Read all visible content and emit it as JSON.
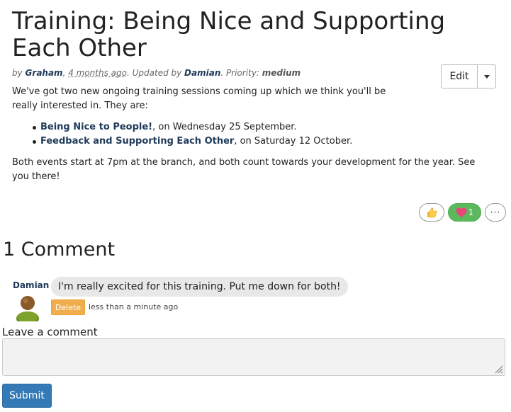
{
  "post": {
    "title": "Training: Being Nice and Supporting Each Other",
    "meta": {
      "by_prefix": "by ",
      "author": "Graham",
      "sep1": ", ",
      "posted_ago": "4 months ago",
      "updated_prefix": ". Updated by ",
      "updated_by": "Damian",
      "priority_prefix": ". Priority: ",
      "priority": "medium"
    },
    "intro": "We've got two new ongoing training sessions coming up which we think you'll be really interested in. They are:",
    "events": [
      {
        "name": "Being Nice to People!",
        "detail": ", on Wednesday 25 September."
      },
      {
        "name": "Feedback and Supporting Each Other",
        "detail": ", on Saturday 12 October."
      }
    ],
    "closing": "Both events start at 7pm at the branch, and both count towards your development for the year. See you there!"
  },
  "actions": {
    "edit_label": "Edit"
  },
  "reactions": {
    "thumb_icon": "thumbs-up-icon",
    "heart_icon": "heart-icon",
    "heart_count": "1",
    "more_icon": "more-icon",
    "more_label": "···"
  },
  "comments": {
    "heading": "1 Comment",
    "items": [
      {
        "author": "Damian",
        "text": "I'm really excited for this training. Put me down for both!",
        "delete_label": "Delete",
        "time": "less than a minute ago"
      }
    ]
  },
  "form": {
    "label": "Leave a comment",
    "value": "",
    "submit_label": "Submit"
  },
  "colors": {
    "link": "#1f3a5a",
    "heart_bg": "#5cb85c",
    "delete_bg": "#f0ad4e",
    "submit_bg": "#337ab7"
  }
}
